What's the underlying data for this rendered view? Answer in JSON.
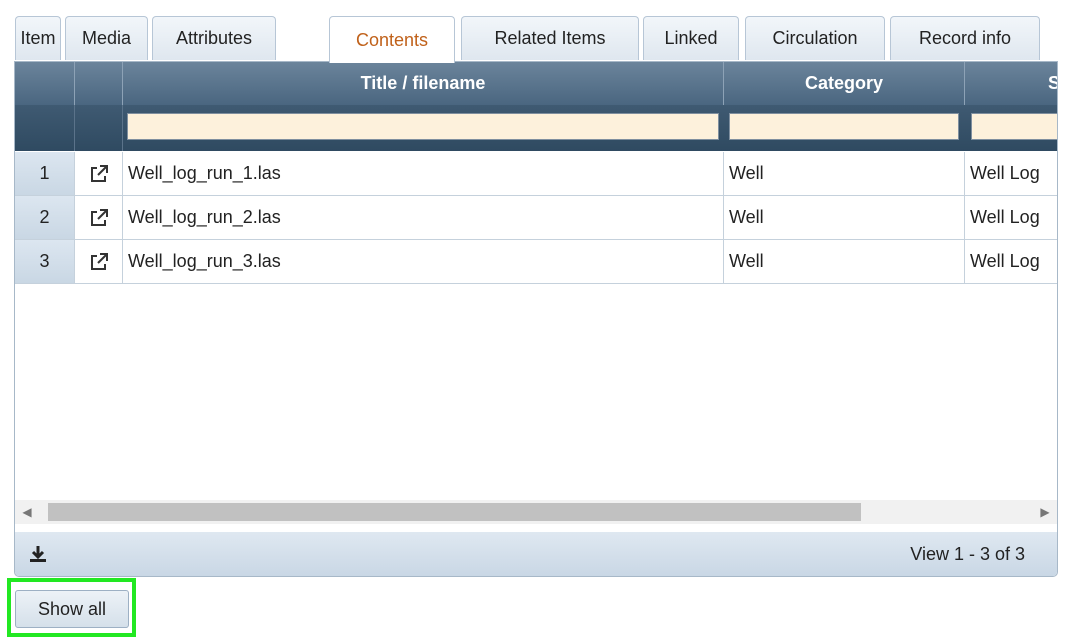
{
  "tabs": [
    {
      "label": "Item",
      "active": false
    },
    {
      "label": "Media",
      "active": false
    },
    {
      "label": "Attributes",
      "active": false
    },
    {
      "label": "Contents",
      "active": true
    },
    {
      "label": "Related Items",
      "active": false
    },
    {
      "label": "Linked",
      "active": false
    },
    {
      "label": "Circulation",
      "active": false
    },
    {
      "label": "Record info",
      "active": false
    }
  ],
  "grid": {
    "columns": [
      "",
      "",
      "Title / filename",
      "Category",
      "S"
    ],
    "filters": {
      "title": "",
      "category": "",
      "s": ""
    },
    "rows": [
      {
        "num": "1",
        "title": "Well_log_run_1.las",
        "category": "Well",
        "s": "Well Log"
      },
      {
        "num": "2",
        "title": "Well_log_run_2.las",
        "category": "Well",
        "s": "Well Log"
      },
      {
        "num": "3",
        "title": "Well_log_run_3.las",
        "category": "Well",
        "s": "Well Log"
      }
    ],
    "row_icon": "external-link-icon",
    "scroll": {
      "left_icon": "scroll-left-arrow-icon",
      "right_icon": "scroll-right-arrow-icon"
    },
    "pager": {
      "download_icon": "download-icon",
      "view_text": "View 1 - 3 of 3"
    }
  },
  "show_all_label": "Show all",
  "colors": {
    "active_tab_text": "#c0611a",
    "highlight": "#22e822",
    "header_bg": "#5a748c",
    "filter_input_bg": "#fdf1dc"
  }
}
